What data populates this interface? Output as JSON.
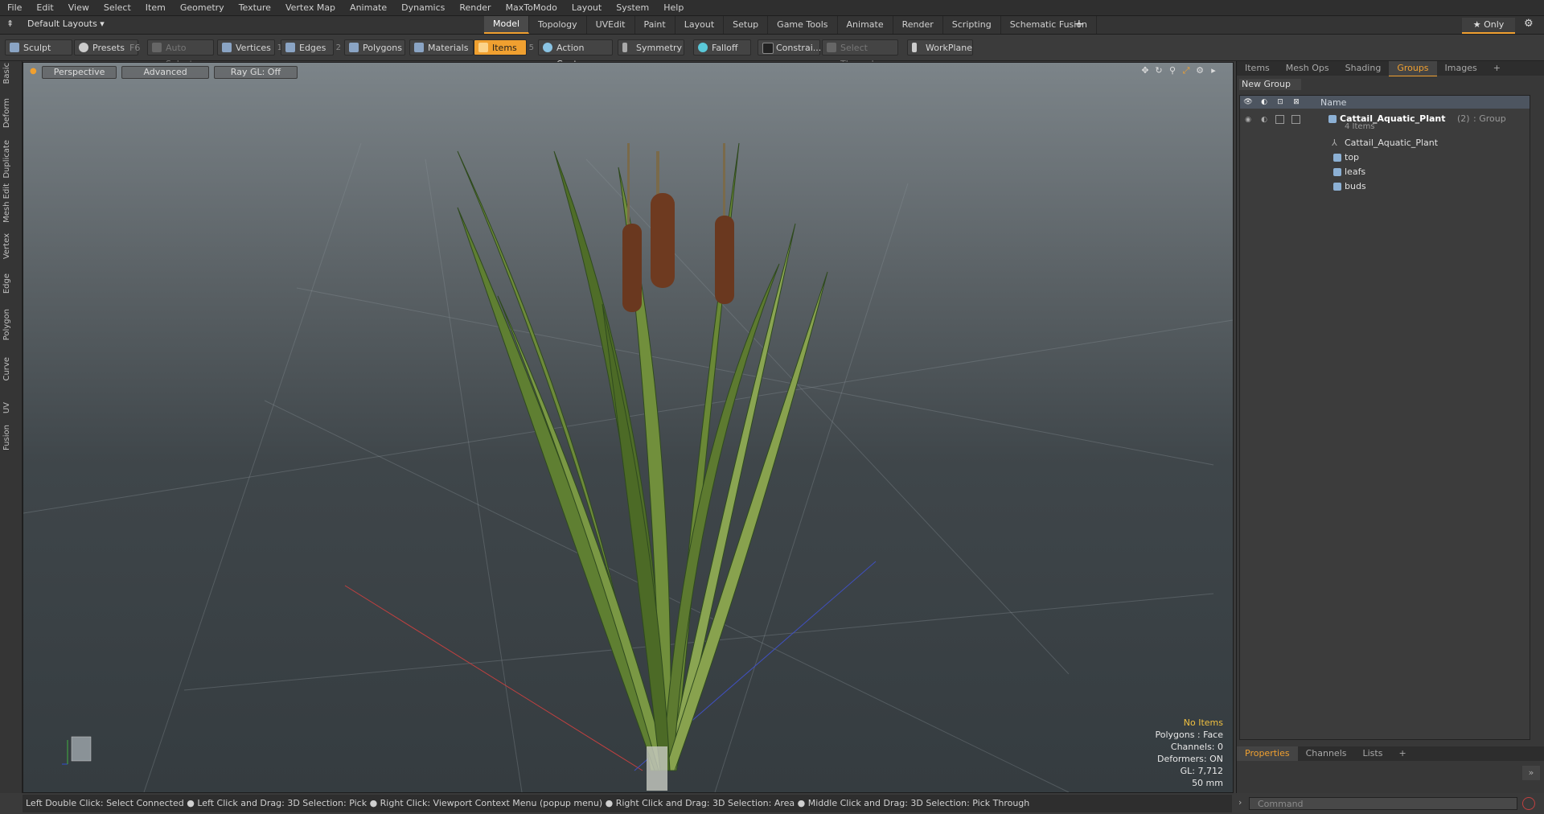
{
  "menu": [
    "File",
    "Edit",
    "View",
    "Select",
    "Item",
    "Geometry",
    "Texture",
    "Vertex Map",
    "Animate",
    "Dynamics",
    "Render",
    "MaxToModo",
    "Layout",
    "System",
    "Help"
  ],
  "layout": {
    "selector": "Default Layouts ▾"
  },
  "tabs": [
    {
      "label": "Model",
      "active": true
    },
    {
      "label": "Topology",
      "active": false
    },
    {
      "label": "UVEdit",
      "active": false
    },
    {
      "label": "Paint",
      "active": false
    },
    {
      "label": "Layout",
      "active": false
    },
    {
      "label": "Setup",
      "active": false
    },
    {
      "label": "Game Tools",
      "active": false
    },
    {
      "label": "Animate",
      "active": false
    },
    {
      "label": "Render",
      "active": false
    },
    {
      "label": "Scripting",
      "active": false
    },
    {
      "label": "Schematic Fusion",
      "active": false
    }
  ],
  "only_label": "★ Only",
  "toolbar": {
    "sculpt": "Sculpt",
    "presets": "Presets",
    "presets_key": "F6",
    "auto_select": "Auto Select",
    "vertices": "Vertices",
    "vertices_num": "1",
    "edges": "Edges",
    "edges_num": "2",
    "polygons": "Polygons",
    "materials": "Materials",
    "items": "Items",
    "items_num": "5",
    "action_center": "Action Center",
    "symmetry": "Symmetry",
    "falloff": "Falloff",
    "constraints": "Constrai...",
    "select_through": "Select Through",
    "workplane": "WorkPlane"
  },
  "left_tabs": [
    "Basic",
    "Deform",
    "Duplicate",
    "Mesh Edit",
    "Vertex",
    "Edge",
    "Polygon",
    "Curve",
    "UV",
    "Fusion"
  ],
  "viewport": {
    "view": "Perspective",
    "shading": "Advanced",
    "raygl": "Ray GL: Off",
    "info": {
      "items": "No Items",
      "polygons": "Polygons : Face",
      "channels": "Channels: 0",
      "deformers": "Deformers: ON",
      "gl": "GL: 7,712",
      "focal": "50 mm"
    }
  },
  "right_panel": {
    "tabs": [
      {
        "label": "Items",
        "active": false
      },
      {
        "label": "Mesh Ops",
        "active": false
      },
      {
        "label": "Shading",
        "active": false
      },
      {
        "label": "Groups",
        "active": true
      },
      {
        "label": "Images",
        "active": false
      },
      {
        "label": "+",
        "active": false
      }
    ],
    "new_group": "New Group",
    "name_header": "Name",
    "group": {
      "name": "Cattail_Aquatic_Plant",
      "count": "(2)",
      "type": ": Group",
      "items_count": "4 Items"
    },
    "children": [
      "Cattail_Aquatic_Plant",
      "top",
      "leafs",
      "buds"
    ],
    "bottom_tabs": [
      {
        "label": "Properties",
        "active": true
      },
      {
        "label": "Channels",
        "active": false
      },
      {
        "label": "Lists",
        "active": false
      },
      {
        "label": "+",
        "active": false
      }
    ]
  },
  "status_text": "Left Double Click: Select Connected ● Left Click and Drag: 3D Selection: Pick ● Right Click: Viewport Context Menu (popup menu) ● Right Click and Drag: 3D Selection: Area ● Middle Click and Drag: 3D Selection: Pick Through",
  "command_placeholder": "Command"
}
